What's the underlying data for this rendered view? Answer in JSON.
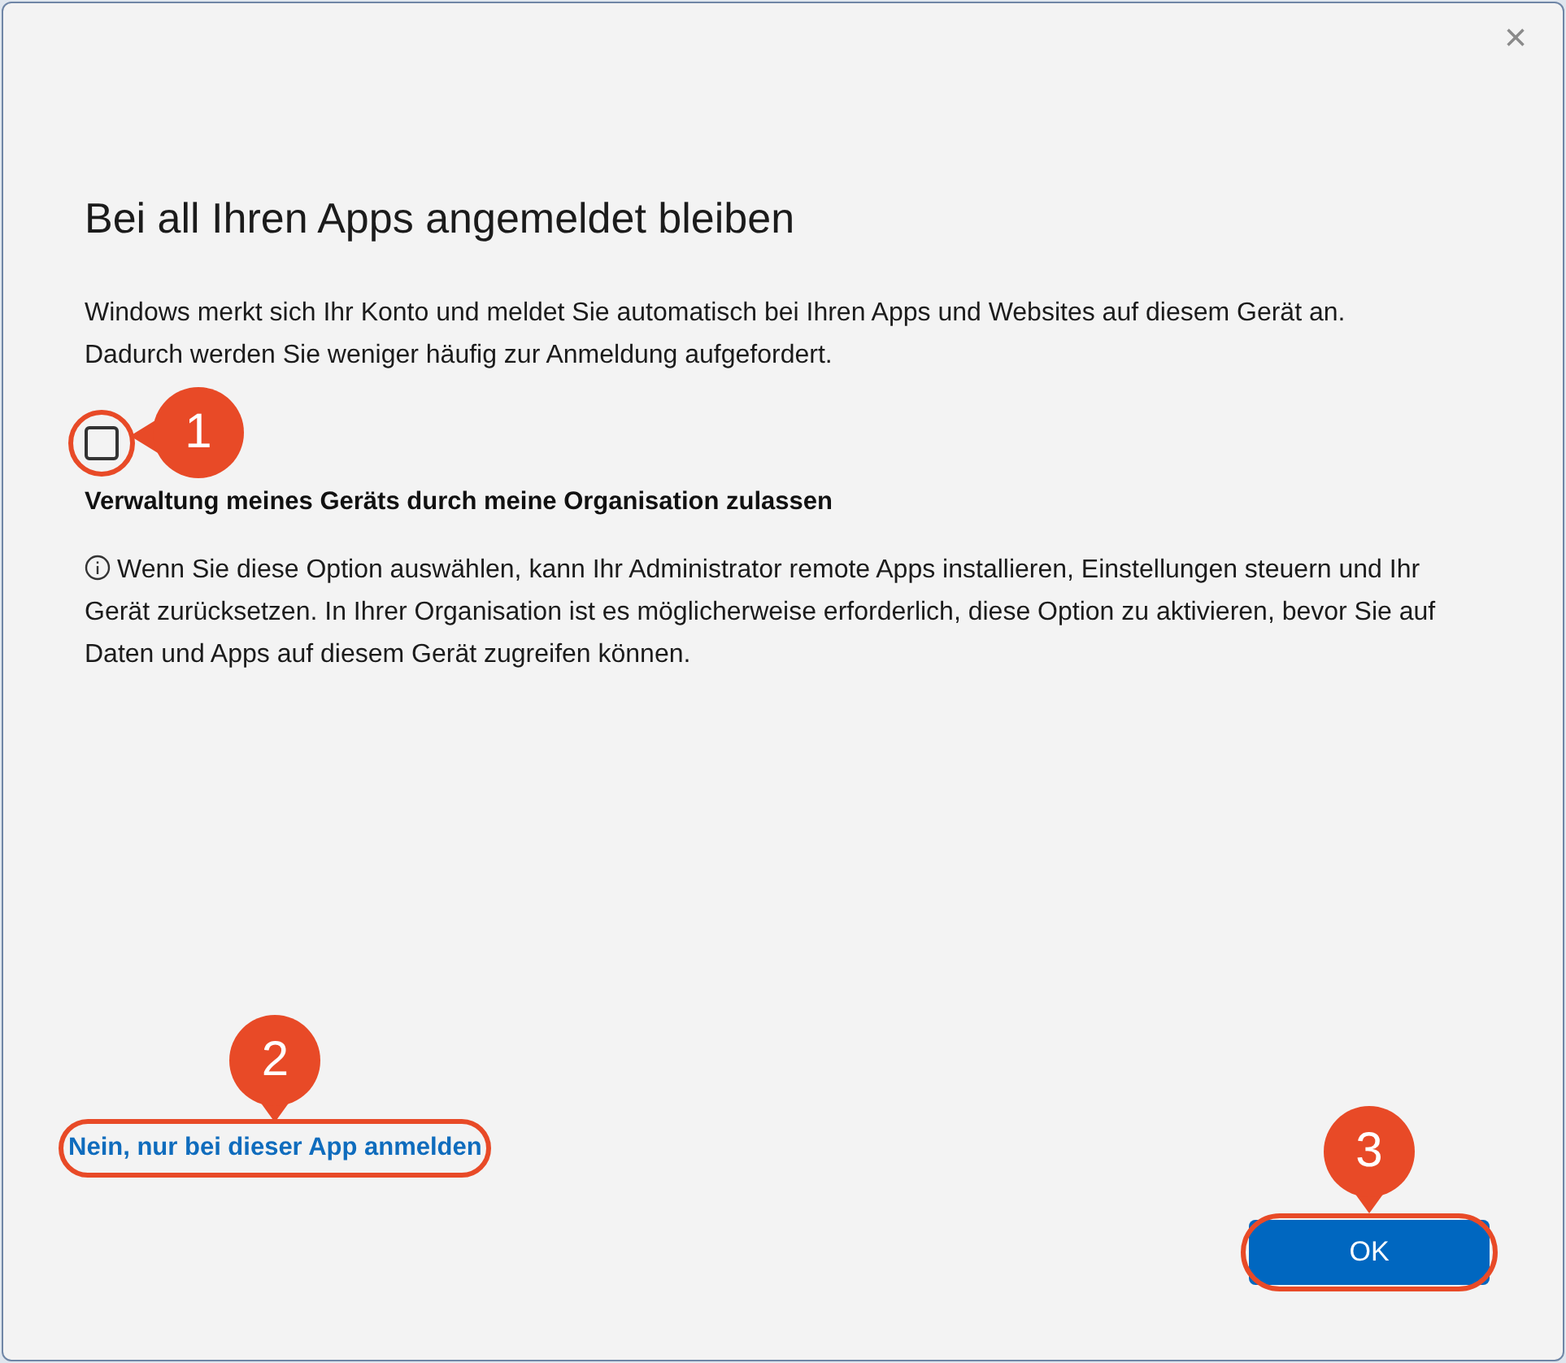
{
  "window": {
    "close": "×"
  },
  "title": "Bei all Ihren Apps angemeldet bleiben",
  "description": "Windows merkt sich Ihr Konto und meldet Sie automatisch bei Ihren Apps und Websites auf diesem Gerät an. Dadurch werden Sie weniger häufig zur Anmeldung aufgefordert.",
  "checkbox": {
    "label": "Verwaltung meines Geräts durch meine Organisation zulassen",
    "checked": false
  },
  "info": "Wenn Sie diese Option auswählen, kann Ihr Administrator remote Apps installieren, Einstellungen steuern und Ihr Gerät zurücksetzen. In Ihrer Organisation ist es möglicherweise erforderlich, diese Option zu aktivieren, bevor Sie auf Daten und Apps auf diesem Gerät zugreifen können.",
  "link": "Nein, nur bei dieser App anmelden",
  "ok_button": "OK",
  "annotations": [
    {
      "number": "1",
      "kind": "left"
    },
    {
      "number": "2",
      "kind": "down"
    },
    {
      "number": "3",
      "kind": "down"
    }
  ]
}
